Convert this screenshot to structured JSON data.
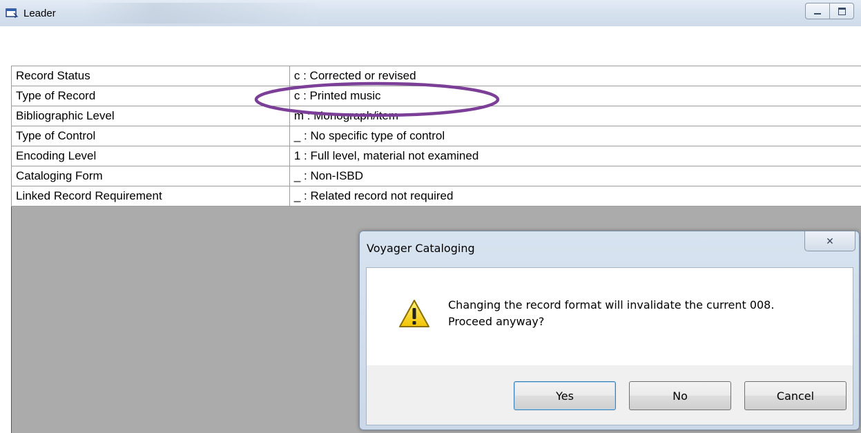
{
  "window": {
    "title": "Leader",
    "icon": "window-app-icon",
    "controls": {
      "minimize": "minimize-icon",
      "maximize": "maximize-icon"
    }
  },
  "leader": {
    "rows": [
      {
        "label": "Record Status",
        "value": "c : Corrected or revised"
      },
      {
        "label": "Type of Record",
        "value": "c : Printed music"
      },
      {
        "label": "Bibliographic Level",
        "value": "m : Monograph/item"
      },
      {
        "label": "Type of Control",
        "value": "_ : No specific type of control"
      },
      {
        "label": "Encoding Level",
        "value": "1 : Full level, material not examined"
      },
      {
        "label": "Cataloging Form",
        "value": "_ : Non-ISBD"
      },
      {
        "label": "Linked Record Requirement",
        "value": "_ : Related record not required"
      }
    ]
  },
  "annotation": {
    "color": "#7b3f98"
  },
  "dialog": {
    "title": "Voyager Cataloging",
    "close_glyph": "✕",
    "icon": "warning-icon",
    "message_line1": "Changing the record format will invalidate the current 008.",
    "message_line2": "Proceed anyway?",
    "buttons": {
      "yes": "Yes",
      "no": "No",
      "cancel": "Cancel"
    }
  }
}
